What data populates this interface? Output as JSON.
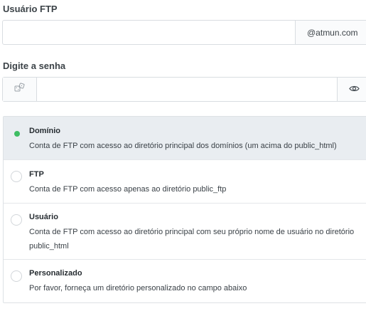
{
  "ftp_user": {
    "label": "Usuário FTP",
    "value": "",
    "domain_suffix": "@atmun.com"
  },
  "password": {
    "label": "Digite a senha",
    "value": "",
    "generate_icon": "dice-icon",
    "toggle_icon": "eye-icon"
  },
  "access_options": [
    {
      "title": "Domínio",
      "description": "Conta de FTP com acesso ao diretório principal dos domínios (um acima do public_html)",
      "selected": true
    },
    {
      "title": "FTP",
      "description": "Conta de FTP com acesso apenas ao diretório public_ftp",
      "selected": false
    },
    {
      "title": "Usuário",
      "description": "Conta de FTP com acesso ao diretório principal com seu próprio nome de usuário no diretório public_html",
      "selected": false
    },
    {
      "title": "Personalizado",
      "description": "Por favor, forneça um diretório personalizado no campo abaixo",
      "selected": false
    }
  ],
  "colors": {
    "selected_radio": "#3ebd63",
    "selected_background": "#e9edf1"
  }
}
